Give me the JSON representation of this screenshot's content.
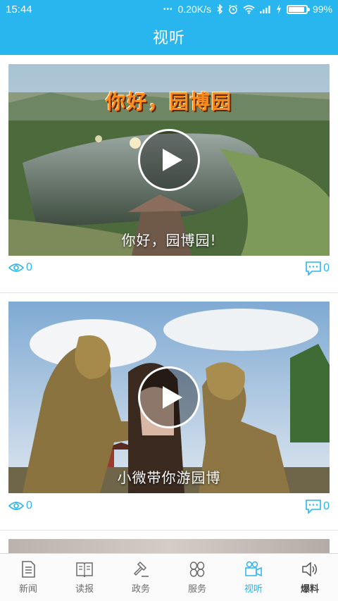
{
  "status_bar": {
    "time": "15:44",
    "dots": "•••",
    "network_speed": "0.20K/s",
    "battery_percent": "99%",
    "battery_level": 0.99,
    "icons": [
      "bluetooth-icon",
      "alarm-icon",
      "wifi-icon",
      "signal-icon",
      "charging-icon",
      "battery-icon"
    ]
  },
  "header": {
    "title": "视听"
  },
  "videos": [
    {
      "overlay_title": "你好，园博园",
      "caption": "你好，园博园!",
      "views": "0",
      "comments": "0"
    },
    {
      "overlay_title": "",
      "caption": "小微带你游园博",
      "views": "0",
      "comments": "0"
    }
  ],
  "tabs": [
    {
      "label": "新闻",
      "icon": "news-icon"
    },
    {
      "label": "读报",
      "icon": "newspaper-icon"
    },
    {
      "label": "政务",
      "icon": "gavel-icon"
    },
    {
      "label": "服务",
      "icon": "services-icon"
    },
    {
      "label": "视听",
      "icon": "video-camera-icon"
    },
    {
      "label": "爆料",
      "icon": "speaker-icon"
    }
  ],
  "colors": {
    "accent": "#29b5ee",
    "tab_inactive": "#6b6b6b",
    "separator": "#e3e3e3"
  }
}
